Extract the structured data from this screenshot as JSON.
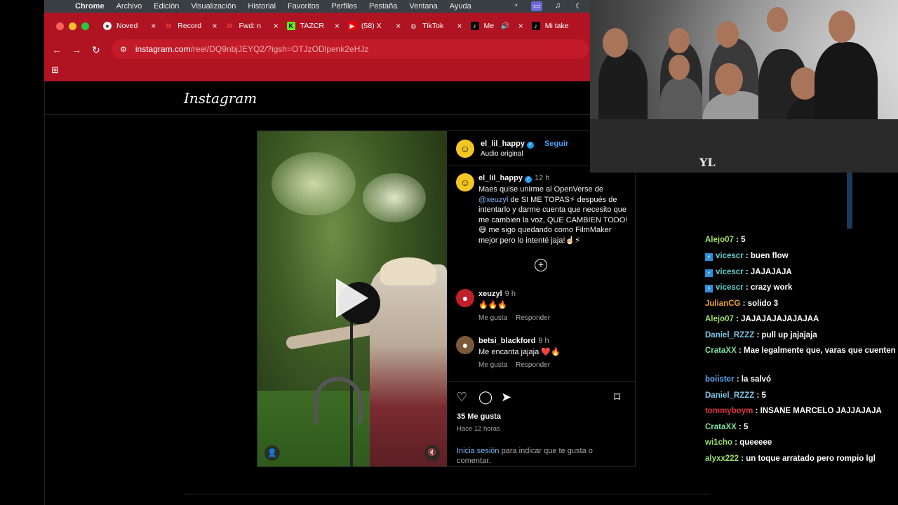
{
  "menubar": {
    "app": "Chrome",
    "items": [
      "Archivo",
      "Edición",
      "Visualización",
      "Historial",
      "Favoritos",
      "Perfiles",
      "Pestaña",
      "Ventana",
      "Ayuda"
    ]
  },
  "tabs": [
    {
      "title": "Noved",
      "icon": "chrome-icon",
      "color": "#f2f2f2"
    },
    {
      "title": "Record",
      "icon": "gmail-icon",
      "color": "#ea4335"
    },
    {
      "title": "Fwd: n",
      "icon": "gmail-icon",
      "color": "#ea4335"
    },
    {
      "title": "TAZCR",
      "icon": "kick-icon",
      "color": "#53fc18"
    },
    {
      "title": "(58) X",
      "icon": "youtube-icon",
      "color": "#ff0000"
    },
    {
      "title": "TikTok",
      "icon": "globe-icon",
      "color": "#cccccc"
    },
    {
      "title": "Me",
      "icon": "tiktok-icon",
      "color": "#000000"
    },
    {
      "title": "Mi take",
      "icon": "tiktok-icon",
      "color": "#000000"
    }
  ],
  "address": {
    "host": "instagram.com",
    "path": "/reel/DQ9nbjJEYQ2/?igsh=OTJzODlpenk2eHJz"
  },
  "instagram": {
    "logo": "Instagram",
    "author": {
      "username": "el_lil_happy",
      "follow": "Seguir",
      "audio": "Audio original"
    },
    "caption": {
      "username": "el_lil_happy",
      "time": "12 h",
      "text_before": "Maes quise unirme al OpenVerse de",
      "mention": "@xeuzyl",
      "text_after": "de SI ME TOPAS⚡ después de intentarlo y darme cuenta que necesito que me cambien la voz, QUE CAMBIEN TODO!😅 me sigo quedando como FilmMaker mejor pero lo intenté jaja!☝🏻⚡"
    },
    "comments": [
      {
        "username": "xeuzyl",
        "time": "9 h",
        "text": "🔥🔥🔥",
        "like": "Me gusta",
        "reply": "Responder"
      },
      {
        "username": "betsi_blackford",
        "time": "9 h",
        "text": "Me encanta jajaja ❤️🔥",
        "like": "Me gusta",
        "reply": "Responder"
      }
    ],
    "likes": "35 Me gusta",
    "posted": "Hace 12 horas",
    "login_link": "Inicia sesión",
    "login_rest": "para indicar que te gusta o comentar."
  },
  "chat": [
    {
      "user": "Alejo07",
      "color": "#9ee06a",
      "text": "5",
      "badge": false
    },
    {
      "user": "vicescr",
      "color": "#5fd0d0",
      "text": "buen flow",
      "badge": true
    },
    {
      "user": "vicescr",
      "color": "#5fd0d0",
      "text": "JAJAJAJA",
      "badge": true
    },
    {
      "user": "vicescr",
      "color": "#5fd0d0",
      "text": "crazy work",
      "badge": true
    },
    {
      "user": "JulianCG",
      "color": "#f0a030",
      "text": "solido 3",
      "badge": false
    },
    {
      "user": "Alejo07",
      "color": "#9ee06a",
      "text": "JAJAJAJAJAJAJAA",
      "badge": false
    },
    {
      "user": "Daniel_RZZZ",
      "color": "#7ec8e8",
      "text": "pull up jajajaja",
      "badge": false
    },
    {
      "user": "CrataXX",
      "color": "#7ee0a0",
      "text": "Mae legalmente que, varas que cuenten mae está en otras bap bap bap",
      "badge": false
    },
    {
      "user": "boiister",
      "color": "#5aa8f0",
      "text": "la salvó",
      "badge": false
    },
    {
      "user": "Daniel_RZZZ",
      "color": "#7ec8e8",
      "text": "5",
      "badge": false
    },
    {
      "user": "tommyboym",
      "color": "#e03040",
      "text": "INSANE MARCELO JAJJAJAJA",
      "badge": false
    },
    {
      "user": "CrataXX",
      "color": "#7ee0a0",
      "text": "5",
      "badge": false
    },
    {
      "user": "wi1cho",
      "color": "#9ee06a",
      "text": "queeeee",
      "badge": false
    },
    {
      "user": "alyxx222",
      "color": "#9ee06a",
      "text": "un toque arratado pero rompio lgl",
      "badge": false
    }
  ],
  "webcam": {
    "sign": "YL"
  }
}
